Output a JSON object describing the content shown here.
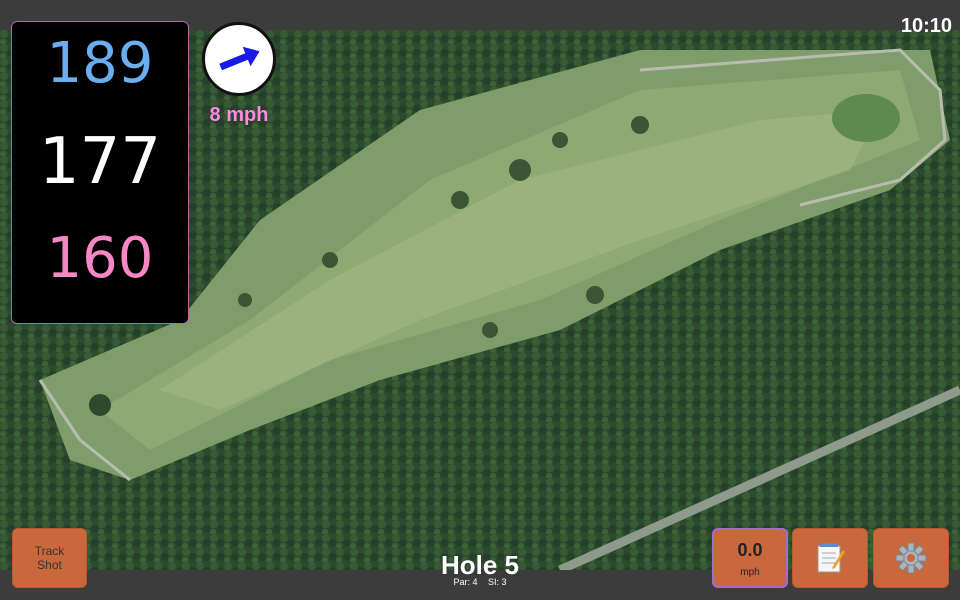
{
  "status": {
    "clock": "10:10"
  },
  "distances": {
    "back": "189",
    "middle": "177",
    "front": "160"
  },
  "wind": {
    "speed_label": "8 mph",
    "icon": "wind-arrow-icon"
  },
  "buttons": {
    "track_shot_line1": "Track",
    "track_shot_line2": "Shot",
    "speed_value": "0.0",
    "speed_unit": "mph",
    "notes_icon": "notepad-icon",
    "settings_icon": "gear-icon"
  },
  "hole": {
    "title": "Hole 5",
    "par": "Par: 4",
    "si": "SI: 3"
  },
  "colors": {
    "back_distance": "#6aaef0",
    "middle_distance": "#ffffff",
    "front_distance": "#f587c4",
    "wind_text": "#ff8ae8",
    "button": "#c8683c"
  }
}
